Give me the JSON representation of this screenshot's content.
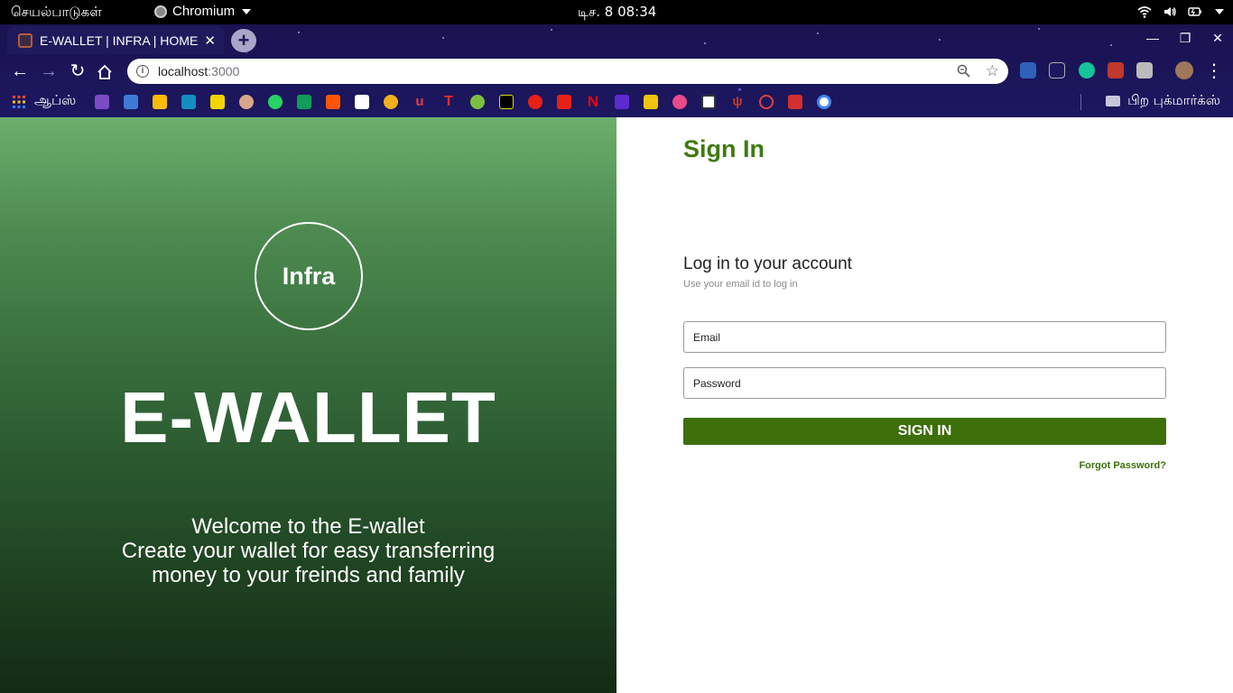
{
  "os": {
    "activities": "செயல்பாடுகள்",
    "app_name": "Chromium",
    "clock": "டிச. 8  08:34"
  },
  "browser": {
    "tab_title": "E-WALLET | INFRA | HOME",
    "url_host": "localhost",
    "url_port": ":3000",
    "apps_label": "ஆப்ஸ்",
    "other_bookmarks": "பிற புக்மார்க்ஸ்"
  },
  "hero": {
    "logo_text": "Infra",
    "brand": "E-WALLET",
    "welcome_line1": "Welcome to the E-wallet",
    "welcome_line2": "Create your wallet for easy transferring",
    "welcome_line3": "money to your freinds and family"
  },
  "login": {
    "title": "Sign In",
    "heading": "Log in to your account",
    "subheading": "Use your email id to log in",
    "email_placeholder": "Email",
    "password_placeholder": "Password",
    "submit_label": "SIGN IN",
    "forgot_label": "Forgot Password?"
  },
  "colors": {
    "accent": "#3d6f0a",
    "title_green": "#3f7a10",
    "browser_bg": "#1d1760"
  }
}
